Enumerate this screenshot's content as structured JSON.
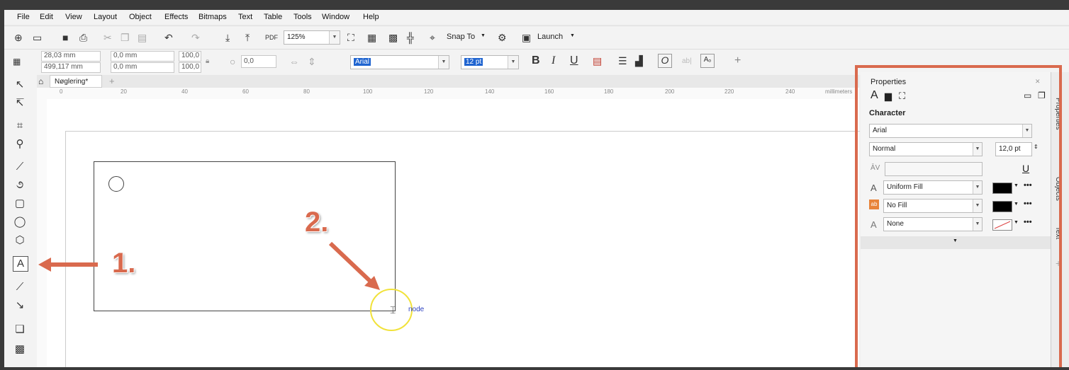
{
  "colors": {
    "accent": "#d96a4e",
    "selection": "#1f64d0",
    "highlight_ring": "#f1e23a"
  },
  "menu": [
    "File",
    "Edit",
    "View",
    "Layout",
    "Object",
    "Effects",
    "Bitmaps",
    "Text",
    "Table",
    "Tools",
    "Window",
    "Help"
  ],
  "toolbar": {
    "zoom": "125%",
    "snap_label": "Snap To",
    "launch_label": "Launch"
  },
  "propbar": {
    "x_value": "28,03 mm",
    "y_value": "499,117 mm",
    "w_value": "0,0 mm",
    "h_value": "0,0 mm",
    "scale_w": "100,0",
    "scale_h": "100,0",
    "angle": "0,0",
    "font": "Arial",
    "size": "12 pt",
    "bold": "B",
    "italic": "I",
    "underline": "U"
  },
  "document_tab": "Nøglering*",
  "ruler_ticks": [
    "0",
    "20",
    "40",
    "60",
    "80",
    "100",
    "120",
    "140",
    "160",
    "180",
    "200",
    "220",
    "240"
  ],
  "ruler_unit": "millimeters",
  "canvas": {
    "snap_hint": "node"
  },
  "properties": {
    "title": "Properties",
    "section": "Character",
    "font": "Arial",
    "style": "Normal",
    "size": "12,0 pt",
    "fill_type": "Uniform Fill",
    "bg_fill": "No Fill",
    "outline": "None",
    "more": "•••"
  },
  "dock_tabs": [
    "Properties",
    "Objects",
    "Text"
  ],
  "annotations": [
    "1.",
    "2."
  ]
}
